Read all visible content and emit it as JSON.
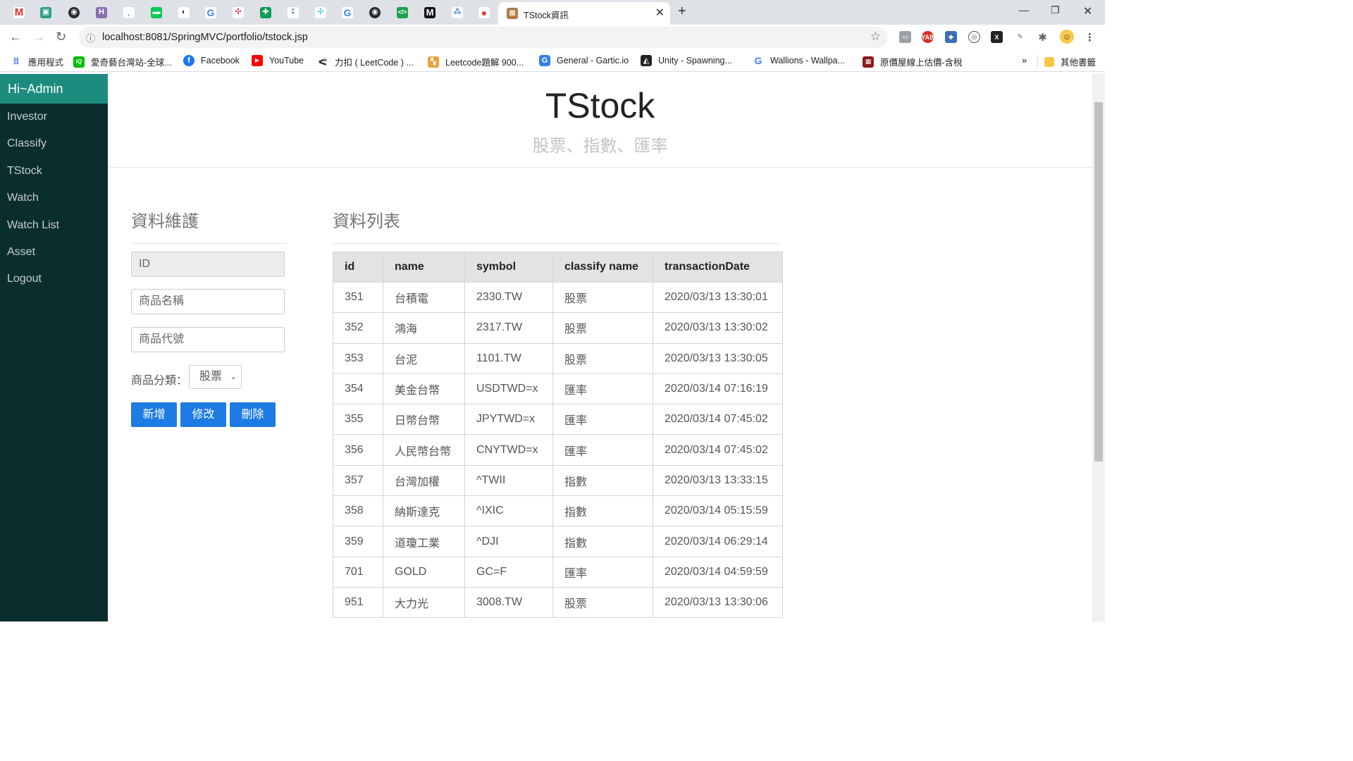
{
  "browser": {
    "active_tab_title": "TStock資訊",
    "url": "localhost:8081/SpringMVC/portfolio/tstock.jsp",
    "bookmarks": [
      "應用程式",
      "愛奇藝台灣站-全球...",
      "Facebook",
      "YouTube",
      "力扣 ( LeetCode ) ...",
      "Leetcode題解 900...",
      "General - Gartic.io",
      "Unity - Spawning...",
      "Wallions - Wallpa...",
      "原價屋線上估價-含稅"
    ],
    "bookmarks_more": "»",
    "other_bookmarks": "其他書籤"
  },
  "sidebar": {
    "brand": "Hi~Admin",
    "items": [
      "Investor",
      "Classify",
      "TStock",
      "Watch",
      "Watch List",
      "Asset",
      "Logout"
    ]
  },
  "header": {
    "title": "TStock",
    "subtitle": "股票、指數、匯率"
  },
  "form": {
    "title": "資料維護",
    "id_placeholder": "ID",
    "name_placeholder": "商品名稱",
    "symbol_placeholder": "商品代號",
    "category_label": "商品分類：",
    "category_value": "股票",
    "buttons": {
      "add": "新增",
      "edit": "修改",
      "delete": "刪除"
    }
  },
  "table": {
    "title": "資料列表",
    "columns": [
      "id",
      "name",
      "symbol",
      "classify name",
      "transactionDate"
    ],
    "rows": [
      [
        "351",
        "台積電",
        "2330.TW",
        "股票",
        "2020/03/13 13:30:01"
      ],
      [
        "352",
        "鴻海",
        "2317.TW",
        "股票",
        "2020/03/13 13:30:02"
      ],
      [
        "353",
        "台泥",
        "1101.TW",
        "股票",
        "2020/03/13 13:30:05"
      ],
      [
        "354",
        "美金台幣",
        "USDTWD=x",
        "匯率",
        "2020/03/14 07:16:19"
      ],
      [
        "355",
        "日幣台幣",
        "JPYTWD=x",
        "匯率",
        "2020/03/14 07:45:02"
      ],
      [
        "356",
        "人民幣台幣",
        "CNYTWD=x",
        "匯率",
        "2020/03/14 07:45:02"
      ],
      [
        "357",
        "台灣加權",
        "^TWII",
        "指數",
        "2020/03/13 13:33:15"
      ],
      [
        "358",
        "納斯達克",
        "^IXIC",
        "指數",
        "2020/03/14 05:15:59"
      ],
      [
        "359",
        "道瓊工業",
        "^DJI",
        "指數",
        "2020/03/14 06:29:14"
      ],
      [
        "701",
        "GOLD",
        "GC=F",
        "匯率",
        "2020/03/14 04:59:59"
      ],
      [
        "951",
        "大力光",
        "3008.TW",
        "股票",
        "2020/03/13 13:30:06"
      ]
    ]
  },
  "colors": {
    "sidebar_bg": "#0a2e2e",
    "brand_bg": "#1c8c7e",
    "button_primary": "#1e7be3"
  }
}
